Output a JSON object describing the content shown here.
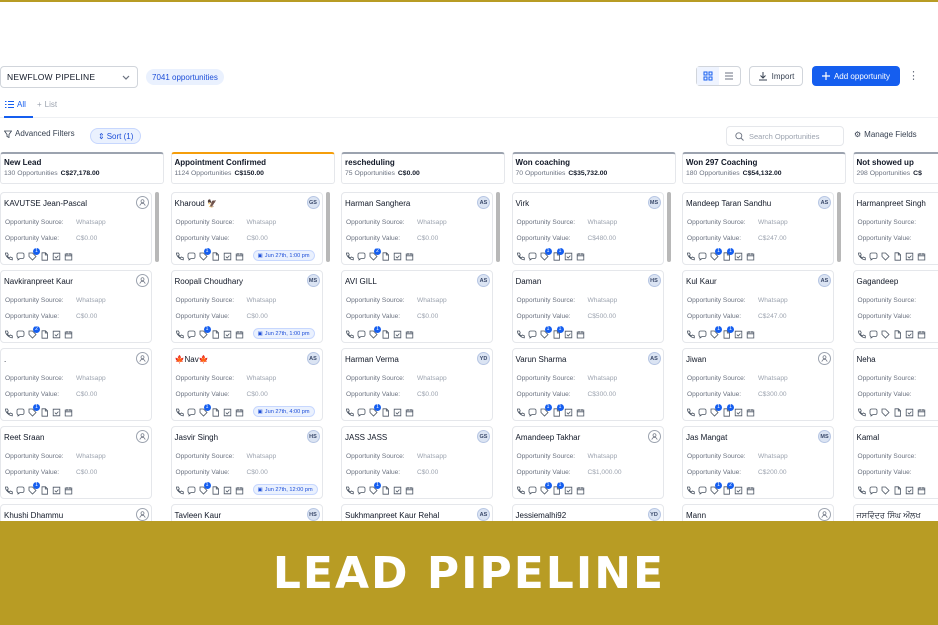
{
  "toolbar": {
    "pipeline": "NEWFLOW PIPELINE",
    "opportunity_count": "7041 opportunities",
    "import_label": "Import",
    "add_label": "Add opportunity"
  },
  "tabs": {
    "all": "All",
    "list": "List"
  },
  "filters": {
    "advanced": "Advanced Filters",
    "sort": "Sort (1)",
    "search_placeholder": "Search Opportunities",
    "manage_fields": "Manage Fields"
  },
  "field_labels": {
    "source": "Opportunity Source:",
    "value": "Opportunity Value:"
  },
  "colors": {
    "accent": "#155eef",
    "banner": "#b89c24"
  },
  "columns": [
    {
      "title": "New Lead",
      "count": "130 Opportunities",
      "total": "C$27,178.00",
      "accent": "#9ca3af",
      "cards": [
        {
          "name": "KAVUTSE Jean-Pascal",
          "avatar": "",
          "source": "Whatsapp",
          "value": "C$0.00",
          "badge": "1",
          "badge2": "",
          "appt": ""
        },
        {
          "name": "Navkiranpreet Kaur",
          "avatar": "",
          "source": "Whatsapp",
          "value": "C$0.00",
          "badge": "2",
          "badge2": "",
          "appt": ""
        },
        {
          "name": ".",
          "avatar": "",
          "source": "Whatsapp",
          "value": "C$0.00",
          "badge": "1",
          "badge2": "",
          "appt": ""
        },
        {
          "name": "Reet Sraan",
          "avatar": "",
          "source": "Whatsapp",
          "value": "C$0.00",
          "badge": "1",
          "badge2": "",
          "appt": ""
        },
        {
          "name": "Khushi Dhammu",
          "avatar": "",
          "source": "",
          "value": "",
          "badge": "",
          "badge2": "",
          "appt": ""
        }
      ]
    },
    {
      "title": "Appointment Confirmed",
      "count": "1124 Opportunities",
      "total": "C$150.00",
      "accent": "#f59e0b",
      "cards": [
        {
          "name": "Kharoud 🦅",
          "avatar": "GS",
          "source": "Whatsapp",
          "value": "C$0.00",
          "badge": "1",
          "badge2": "",
          "appt": "Jun 27th, 1:00 pm"
        },
        {
          "name": "Roopali Choudhary",
          "avatar": "MS",
          "source": "Whatsapp",
          "value": "C$0.00",
          "badge": "1",
          "badge2": "",
          "appt": "Jun 27th, 1:00 pm"
        },
        {
          "name": "🍁Nav🍁",
          "avatar": "AS",
          "source": "Whatsapp",
          "value": "C$0.00",
          "badge": "1",
          "badge2": "",
          "appt": "Jun 27th, 4:00 pm"
        },
        {
          "name": "Jasvir Singh",
          "avatar": "HS",
          "source": "Whatsapp",
          "value": "C$0.00",
          "badge": "1",
          "badge2": "",
          "appt": "Jun 27th, 12:00 pm"
        },
        {
          "name": "Tavleen Kaur",
          "avatar": "HS",
          "source": "",
          "value": "",
          "badge": "",
          "badge2": "",
          "appt": ""
        }
      ]
    },
    {
      "title": "rescheduling",
      "count": "75 Opportunities",
      "total": "C$0.00",
      "accent": "#9ca3af",
      "cards": [
        {
          "name": "Harman Sanghera",
          "avatar": "AS",
          "source": "Whatsapp",
          "value": "C$0.00",
          "badge": "2",
          "badge2": "",
          "appt": ""
        },
        {
          "name": "AVI GILL",
          "avatar": "AS",
          "source": "Whatsapp",
          "value": "C$0.00",
          "badge": "1",
          "badge2": "",
          "appt": ""
        },
        {
          "name": "Harman Verma",
          "avatar": "YD",
          "source": "Whatsapp",
          "value": "C$0.00",
          "badge": "1",
          "badge2": "",
          "appt": ""
        },
        {
          "name": "JASS JASS",
          "avatar": "GS",
          "source": "Whatsapp",
          "value": "C$0.00",
          "badge": "1",
          "badge2": "",
          "appt": ""
        },
        {
          "name": "Sukhmanpreet Kaur Rehal",
          "avatar": "AS",
          "source": "",
          "value": "",
          "badge": "",
          "badge2": "",
          "appt": ""
        }
      ]
    },
    {
      "title": "Won coaching",
      "count": "70 Opportunities",
      "total": "C$35,732.00",
      "accent": "#9ca3af",
      "cards": [
        {
          "name": "Virk",
          "avatar": "MS",
          "source": "Whatsapp",
          "value": "C$480.00",
          "badge": "1",
          "badge2": "1",
          "appt": ""
        },
        {
          "name": "Daman",
          "avatar": "HS",
          "source": "Whatsapp",
          "value": "C$500.00",
          "badge": "1",
          "badge2": "1",
          "appt": ""
        },
        {
          "name": "Varun Sharma",
          "avatar": "AS",
          "source": "Whatsapp",
          "value": "C$300.00",
          "badge": "1",
          "badge2": "1",
          "appt": ""
        },
        {
          "name": "Amandeep Takhar",
          "avatar": "",
          "source": "Whatsapp",
          "value": "C$1,000.00",
          "badge": "1",
          "badge2": "1",
          "appt": ""
        },
        {
          "name": "Jessiemalhi92",
          "avatar": "YD",
          "source": "",
          "value": "",
          "badge": "",
          "badge2": "",
          "appt": ""
        }
      ]
    },
    {
      "title": "Won 297 Coaching",
      "count": "180 Opportunities",
      "total": "C$54,132.00",
      "accent": "#9ca3af",
      "cards": [
        {
          "name": "Mandeep Taran Sandhu",
          "avatar": "AS",
          "source": "Whatsapp",
          "value": "C$247.00",
          "badge": "1",
          "badge2": "1",
          "appt": ""
        },
        {
          "name": "Kul Kaur",
          "avatar": "AS",
          "source": "Whatsapp",
          "value": "C$247.00",
          "badge": "1",
          "badge2": "1",
          "appt": ""
        },
        {
          "name": "Jiwan",
          "avatar": "",
          "source": "Whatsapp",
          "value": "C$300.00",
          "badge": "1",
          "badge2": "1",
          "appt": ""
        },
        {
          "name": "Jas Mangat",
          "avatar": "MS",
          "source": "Whatsapp",
          "value": "C$200.00",
          "badge": "1",
          "badge2": "2",
          "appt": ""
        },
        {
          "name": "Mann",
          "avatar": "",
          "source": "",
          "value": "",
          "badge": "",
          "badge2": "",
          "appt": ""
        }
      ]
    },
    {
      "title": "Not showed up",
      "count": "298 Opportunities",
      "total": "C$",
      "accent": "#9ca3af",
      "cards": [
        {
          "name": "Harmanpreet Singh",
          "avatar": "",
          "source": "",
          "value": "",
          "badge": "",
          "badge2": "",
          "appt": ""
        },
        {
          "name": "Gagandeep",
          "avatar": "",
          "source": "",
          "value": "",
          "badge": "",
          "badge2": "",
          "appt": ""
        },
        {
          "name": "Neha",
          "avatar": "",
          "source": "",
          "value": "",
          "badge": "",
          "badge2": "",
          "appt": ""
        },
        {
          "name": "Kamal",
          "avatar": "",
          "source": "",
          "value": "",
          "badge": "",
          "badge2": "",
          "appt": ""
        },
        {
          "name": "ਜਸਵਿੰਦਰ ਸਿੰਘ ਔਲਖ",
          "avatar": "",
          "source": "",
          "value": "",
          "badge": "",
          "badge2": "",
          "appt": ""
        }
      ]
    }
  ],
  "banner": {
    "title": "LEAD PIPELINE"
  }
}
